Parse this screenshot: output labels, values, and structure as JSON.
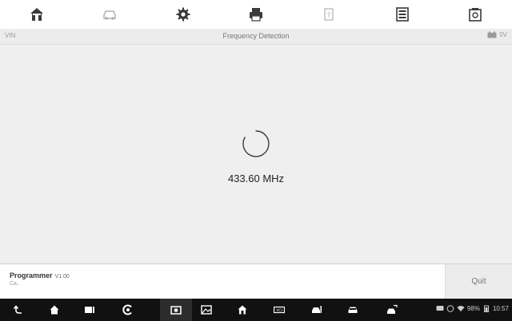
{
  "toolbar": {
    "items": [
      {
        "icon": "home-icon"
      },
      {
        "icon": "vehicle-icon"
      },
      {
        "icon": "settings-icon"
      },
      {
        "icon": "print-icon"
      },
      {
        "icon": "help-icon"
      },
      {
        "icon": "data-manager-icon"
      },
      {
        "icon": "screenshot-icon"
      }
    ]
  },
  "infobar": {
    "vin": "VIN",
    "title": "Frequency Detection",
    "battery_value": "0V"
  },
  "main": {
    "frequency": "433.60 MHz"
  },
  "footer": {
    "app_name": "Programmer",
    "version": "V1.00",
    "sub": "Ca.."
  },
  "quit_label": "Quit",
  "navbar": {
    "status": {
      "battery": "98%",
      "time": "10:57"
    }
  },
  "colors": {
    "toolbar_icon": "#3a3a3a",
    "toolbar_icon_disabled": "#b0b0b0",
    "nav_bg": "#111111"
  }
}
